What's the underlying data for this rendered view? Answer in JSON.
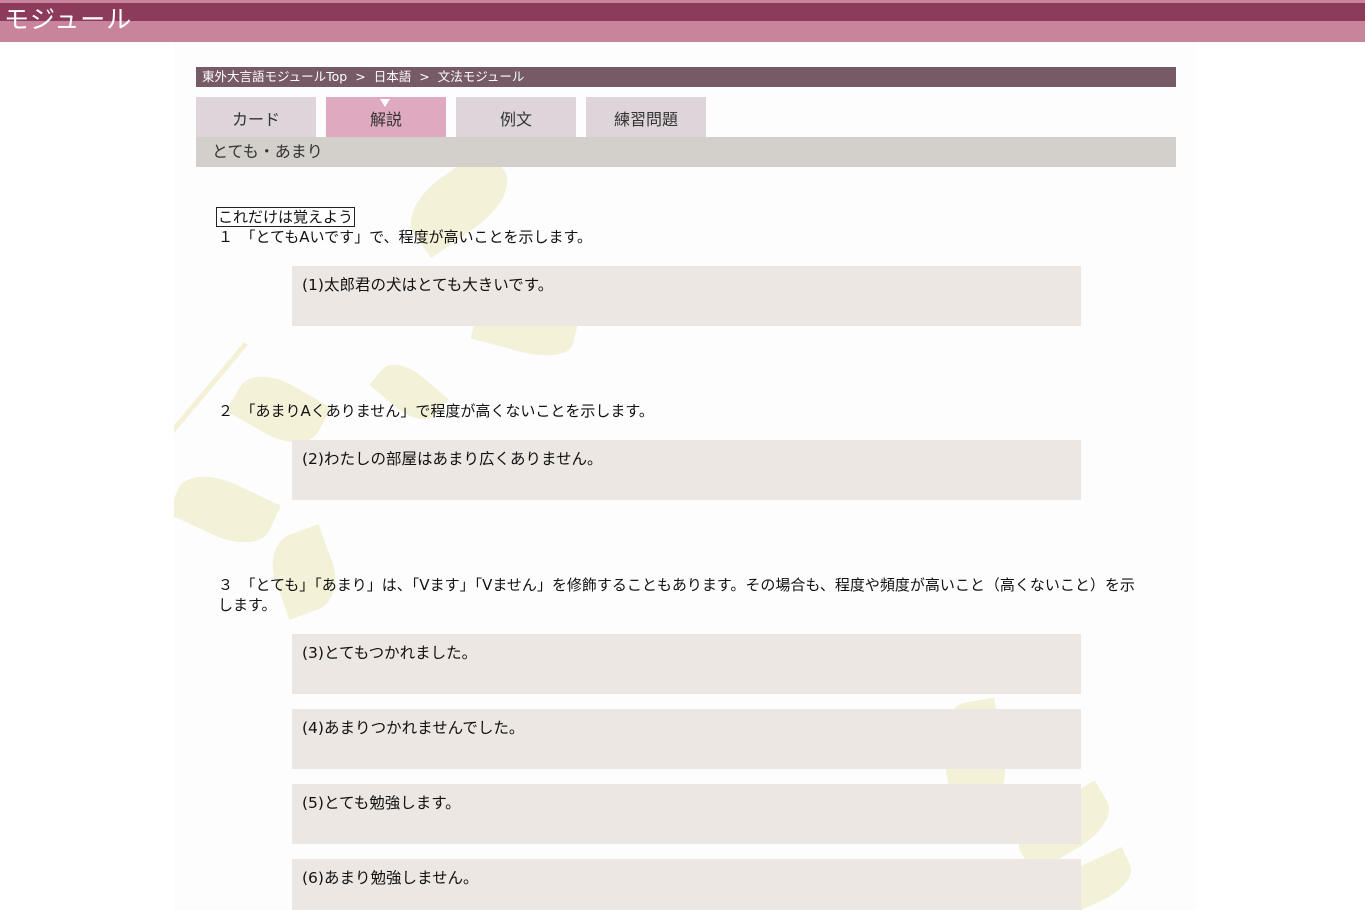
{
  "header": {
    "site_title": "モジュール"
  },
  "breadcrumb": {
    "items": [
      "東外大言語モジュールTop",
      "日本語",
      "文法モジュール"
    ],
    "separator": ">"
  },
  "tabs": [
    {
      "label": "カード",
      "active": false
    },
    {
      "label": "解説",
      "active": true
    },
    {
      "label": "例文",
      "active": false
    },
    {
      "label": "練習問題",
      "active": false
    }
  ],
  "grammar": {
    "title": "とても・あまり"
  },
  "content": {
    "memorize_label": "これだけは覚えよう",
    "points": [
      {
        "text": "１　「とてもAいです」で、程度が高いことを示します。",
        "examples": [
          "(1)太郎君の犬はとても大きいです。"
        ]
      },
      {
        "text": "２　「あまりAくありません」で程度が高くないことを示します。",
        "examples": [
          "(2)わたしの部屋はあまり広くありません。"
        ]
      },
      {
        "text": "３　「とても」「あまり」は、「Vます」「Vません」を修飾することもあります。その場合も、程度や頻度が高いこと（高くないこと）を示します。",
        "examples": [
          "(3)とてもつかれました。",
          "(4)あまりつかれませんでした。",
          "(5)とても勉強します。",
          "(6)あまり勉強しません。"
        ]
      }
    ]
  },
  "colors": {
    "header_dark": "#8d3b5a",
    "header_light": "#c7849a",
    "breadcrumb_bg": "#765a66",
    "tab_bg": "#ddd5d9",
    "tab_active_bg": "#dfa9bf",
    "grammar_bar_bg": "#d3d0cb",
    "example_bg": "#ece7e3",
    "leaf_decoration": "#f3f1d8"
  }
}
